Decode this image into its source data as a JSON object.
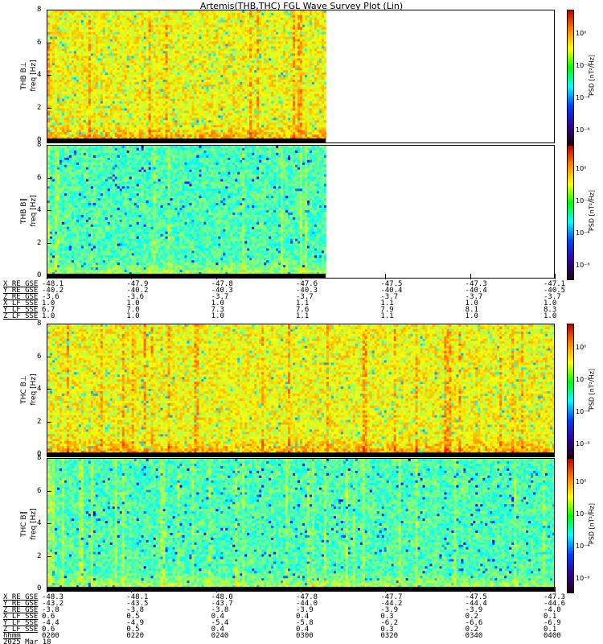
{
  "title": "Artemis(THB,THC) FGL Wave Survey Plot (Lin)",
  "colorbar": {
    "label": "PSD [nT²/Hz]",
    "ticks": [
      "10⁰",
      "10⁻²",
      "10⁻⁴",
      "10⁻⁶"
    ]
  },
  "yticks": [
    "8",
    "6",
    "4",
    "2",
    "0"
  ],
  "groups": [
    {
      "panels": [
        {
          "name": "THB B⊥",
          "unit": "freq [Hz]",
          "coverage": 0.55,
          "level": 0.62
        },
        {
          "name": "THB B∥",
          "unit": "freq [Hz]",
          "coverage": 0.55,
          "level": 0.45
        }
      ],
      "rows": [
        {
          "label": "X_RE_GSE",
          "values": [
            "-48.1",
            "-47.9",
            "-47.8",
            "-47.6",
            "-47.5",
            "-47.3",
            "-47.1"
          ]
        },
        {
          "label": "Y_RE_GSE",
          "values": [
            "-40.2",
            "-40.2",
            "-40.3",
            "-40.3",
            "-40.4",
            "-40.4",
            "-40.5"
          ]
        },
        {
          "label": "Z_RE_GSE",
          "values": [
            "-3.6",
            "-3.6",
            "-3.7",
            "-3.7",
            "-3.7",
            "-3.7",
            "-3.7"
          ]
        },
        {
          "label": "X_LF_SSE",
          "values": [
            "1.0",
            "1.0",
            "1.0",
            "1.1",
            "1.1",
            "1.0",
            "1.0"
          ]
        },
        {
          "label": "Y_LF_SSE",
          "values": [
            "6.7",
            "7.0",
            "7.3",
            "7.6",
            "7.9",
            "8.1",
            "8.3"
          ]
        },
        {
          "label": "Z_LF_SSE",
          "values": [
            "1.0",
            "1.0",
            "1.0",
            "1.1",
            "1.1",
            "1.0",
            "1.0"
          ]
        }
      ]
    },
    {
      "panels": [
        {
          "name": "THC B⊥",
          "unit": "freq [Hz]",
          "coverage": 1.0,
          "level": 0.62
        },
        {
          "name": "THC B∥",
          "unit": "freq [Hz]",
          "coverage": 1.0,
          "level": 0.45
        }
      ],
      "rows": [
        {
          "label": "X_RE_GSE",
          "values": [
            "-48.3",
            "-48.1",
            "-48.0",
            "-47.8",
            "-47.7",
            "-47.5",
            "-47.3"
          ]
        },
        {
          "label": "Y_RE_GSE",
          "values": [
            "-43.2",
            "-43.5",
            "-43.7",
            "-44.0",
            "-44.2",
            "-44.4",
            "-44.6"
          ]
        },
        {
          "label": "Z_RE_GSE",
          "values": [
            "-3.8",
            "-3.8",
            "-3.8",
            "-3.9",
            "-3.9",
            "-3.9",
            "-4.0"
          ]
        },
        {
          "label": "X_LF_SSE",
          "values": [
            "0.6",
            "0.5",
            "0.4",
            "0.4",
            "0.3",
            "0.2",
            "0.1"
          ]
        },
        {
          "label": "Y_LF_SSE",
          "values": [
            "-4.4",
            "-4.9",
            "-5.4",
            "-5.8",
            "-6.2",
            "-6.6",
            "-6.9"
          ]
        },
        {
          "label": "Z_LF_SSE",
          "values": [
            "0.6",
            "0.5",
            "0.4",
            "0.4",
            "0.3",
            "0.2",
            "0.1"
          ]
        },
        {
          "label": "hhmm",
          "values": [
            "0200",
            "0220",
            "0240",
            "0300",
            "0320",
            "0340",
            "0400"
          ]
        }
      ],
      "date": "2025 Mar 18"
    }
  ]
}
